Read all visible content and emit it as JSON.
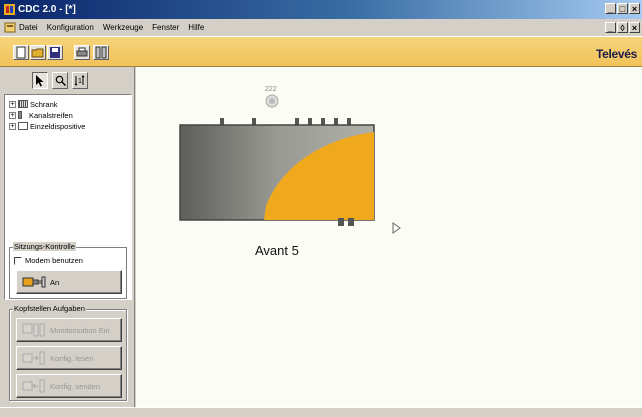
{
  "window": {
    "title": "CDC 2.0 - [*]",
    "controls": [
      "_",
      "□",
      "×"
    ],
    "mdi_controls": [
      "_",
      "◊",
      "×"
    ]
  },
  "menu": {
    "items": [
      "Datei",
      "Konfiguration",
      "Werkzeuge",
      "Fenster",
      "Hilfe"
    ]
  },
  "toolbar": {
    "brand": "Televés"
  },
  "left_panel": {
    "tools": [
      "pointer-icon",
      "search-icon",
      "numbering-icon"
    ],
    "tree": [
      {
        "label": "Schrank"
      },
      {
        "label": "Kanalstreifen"
      },
      {
        "label": "Einzeldispositive"
      }
    ],
    "session": {
      "legend": "Sitzungs-Kontrolle",
      "modem_label": "Modem benutzen",
      "connect_label": "An"
    },
    "tasks": {
      "legend": "Kopfstellen Aufgaben",
      "buttons": [
        "Monitorisation Ein",
        "Konfig. lesen",
        "Konfig. senden"
      ]
    }
  },
  "canvas": {
    "node_id": "222",
    "device_label": "Avant 5"
  },
  "colors": {
    "accent_orange": "#f0a81c",
    "device_gray": "#7c7c78",
    "toolbar_gold": "#f3c960"
  }
}
